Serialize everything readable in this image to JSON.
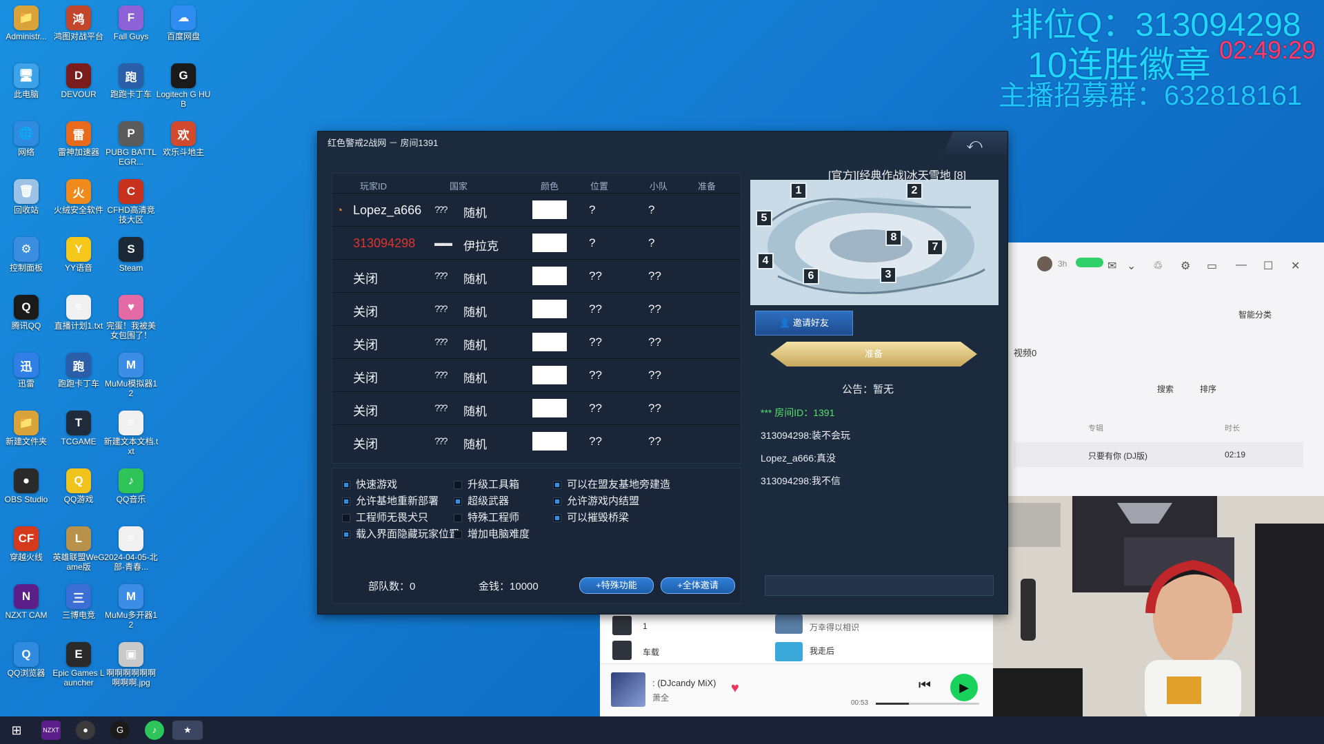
{
  "desktop_icons": [
    {
      "label": "Administr...",
      "color": "#d9a33a",
      "glyph": "📁"
    },
    {
      "label": "鸿图对战平台",
      "color": "#c2462c",
      "glyph": "鸿"
    },
    {
      "label": "Fall Guys",
      "color": "#8c62d6",
      "glyph": "F"
    },
    {
      "label": "百度网盘",
      "color": "#2f8cf0",
      "glyph": "☁"
    },
    {
      "label": "此电脑",
      "color": "#3da2e8",
      "glyph": "🖥"
    },
    {
      "label": "DEVOUR",
      "color": "#7a1c1c",
      "glyph": "D"
    },
    {
      "label": "跑跑卡丁车",
      "color": "#2b5ea8",
      "glyph": "跑"
    },
    {
      "label": "Logitech G HUB",
      "color": "#1a1a1a",
      "glyph": "G"
    },
    {
      "label": "网络",
      "color": "#2f8be0",
      "glyph": "🌐"
    },
    {
      "label": "雷神加速器",
      "color": "#e86a1c",
      "glyph": "雷"
    },
    {
      "label": "PUBG BATTLEGR...",
      "color": "#5b5b5b",
      "glyph": "P"
    },
    {
      "label": "欢乐斗地主",
      "color": "#d24a2e",
      "glyph": "欢"
    },
    {
      "label": "回收站",
      "color": "#9cc3e6",
      "glyph": "🗑"
    },
    {
      "label": "火绒安全软件",
      "color": "#f08a1c",
      "glyph": "火"
    },
    {
      "label": "CFHD高清竞技大区",
      "color": "#c7321e",
      "glyph": "C"
    },
    {
      "label": "",
      "color": "transparent",
      "glyph": ""
    },
    {
      "label": "控制面板",
      "color": "#3b8de0",
      "glyph": "⚙"
    },
    {
      "label": "YY语音",
      "color": "#f5c71a",
      "glyph": "Y"
    },
    {
      "label": "Steam",
      "color": "#1b2838",
      "glyph": "S"
    },
    {
      "label": "",
      "color": "transparent",
      "glyph": ""
    },
    {
      "label": "腾讯QQ",
      "color": "#1a1a1a",
      "glyph": "Q"
    },
    {
      "label": "直播计划1.txt",
      "color": "#f0f0f0",
      "glyph": "≡"
    },
    {
      "label": "完蛋！我被美女包围了！",
      "color": "#e46aa6",
      "glyph": "♥"
    },
    {
      "label": "",
      "color": "transparent",
      "glyph": ""
    },
    {
      "label": "迅雷",
      "color": "#2f7fe6",
      "glyph": "迅"
    },
    {
      "label": "跑跑卡丁车",
      "color": "#2b5ea8",
      "glyph": "跑"
    },
    {
      "label": "MuMu模拟器12",
      "color": "#3b8de6",
      "glyph": "M"
    },
    {
      "label": "",
      "color": "transparent",
      "glyph": ""
    },
    {
      "label": "新建文件夹",
      "color": "#d9a33a",
      "glyph": "📁"
    },
    {
      "label": "TCGAME",
      "color": "#1f2a3a",
      "glyph": "T"
    },
    {
      "label": "新建文本文档.txt",
      "color": "#f0f0f0",
      "glyph": "≡"
    },
    {
      "label": "",
      "color": "transparent",
      "glyph": ""
    },
    {
      "label": "OBS Studio",
      "color": "#2a2a2a",
      "glyph": "●"
    },
    {
      "label": "QQ游戏",
      "color": "#f0c21c",
      "glyph": "Q"
    },
    {
      "label": "QQ音乐",
      "color": "#2fc45a",
      "glyph": "♪"
    },
    {
      "label": "",
      "color": "transparent",
      "glyph": ""
    },
    {
      "label": "穿越火线",
      "color": "#d63a1c",
      "glyph": "CF"
    },
    {
      "label": "英雄联盟WeGame版",
      "color": "#b8914a",
      "glyph": "L"
    },
    {
      "label": "2024-04-05-北部-青春...",
      "color": "#f0f0f0",
      "glyph": "≡"
    },
    {
      "label": "",
      "color": "transparent",
      "glyph": ""
    },
    {
      "label": "NZXT CAM",
      "color": "#5c1f8a",
      "glyph": "N"
    },
    {
      "label": "三博电竞",
      "color": "#3b6fd6",
      "glyph": "三"
    },
    {
      "label": "MuMu多开器12",
      "color": "#3b8de6",
      "glyph": "M"
    },
    {
      "label": "",
      "color": "transparent",
      "glyph": ""
    },
    {
      "label": "QQ浏览器",
      "color": "#2f8be0",
      "glyph": "Q"
    },
    {
      "label": "Epic Games Launcher",
      "color": "#2a2a2a",
      "glyph": "E"
    },
    {
      "label": "啊啊啊啊啊啊啊啊啊.jpg",
      "color": "#c9c9c9",
      "glyph": "▣"
    }
  ],
  "overlay": {
    "line1": "排位Q：313094298",
    "line2": "10连胜徽章",
    "time": "02:49:29",
    "line3": "主播招募群：632818161"
  },
  "game": {
    "title": "红色警戒2战网 － 房间1391",
    "headers": {
      "id": "玩家ID",
      "nation": "国家",
      "color": "颜色",
      "position": "位置",
      "team": "小队",
      "ready": "准备"
    },
    "players": [
      {
        "id": "Lopez_a666",
        "flag": "???",
        "nation": "随机",
        "pos": "?",
        "team": "?",
        "id_color": "#f1f4f8"
      },
      {
        "id": "313094298",
        "flag": "▬▬",
        "nation": "伊拉克",
        "pos": "?",
        "team": "?",
        "id_color": "#e0332e"
      },
      {
        "id": "关闭",
        "flag": "???",
        "nation": "随机",
        "pos": "??",
        "team": "??",
        "id_color": "#f1f4f8"
      },
      {
        "id": "关闭",
        "flag": "???",
        "nation": "随机",
        "pos": "??",
        "team": "??",
        "id_color": "#f1f4f8"
      },
      {
        "id": "关闭",
        "flag": "???",
        "nation": "随机",
        "pos": "??",
        "team": "??",
        "id_color": "#f1f4f8"
      },
      {
        "id": "关闭",
        "flag": "???",
        "nation": "随机",
        "pos": "??",
        "team": "??",
        "id_color": "#f1f4f8"
      },
      {
        "id": "关闭",
        "flag": "???",
        "nation": "随机",
        "pos": "??",
        "team": "??",
        "id_color": "#f1f4f8"
      },
      {
        "id": "关闭",
        "flag": "???",
        "nation": "随机",
        "pos": "??",
        "team": "??",
        "id_color": "#f1f4f8"
      }
    ],
    "options": [
      {
        "label": "快速游戏",
        "on": true
      },
      {
        "label": "升级工具箱",
        "on": false
      },
      {
        "label": "可以在盟友基地旁建造",
        "on": true
      },
      {
        "label": "允许基地重新部署",
        "on": true
      },
      {
        "label": "超级武器",
        "on": true
      },
      {
        "label": "允许游戏内结盟",
        "on": true
      },
      {
        "label": "工程师无畏犬只",
        "on": false
      },
      {
        "label": "特殊工程师",
        "on": false
      },
      {
        "label": "可以摧毁桥梁",
        "on": true
      },
      {
        "label": "载入界面隐藏玩家位置",
        "on": true
      },
      {
        "label": "增加电脑难度",
        "on": false
      }
    ],
    "units_label": "部队数：",
    "units_value": "0",
    "money_label": "金钱：",
    "money_value": "10000",
    "special_btn": "+特殊功能",
    "invite_all_btn": "+全体邀请",
    "map_title": "[官方][经典作战]冰天雪地 [8]",
    "map_numbers": [
      "1",
      "2",
      "5",
      "8",
      "7",
      "4",
      "6",
      "3"
    ],
    "invite_btn": "邀请好友",
    "ready_btn": "准备",
    "notice": "公告：暂无",
    "chat": [
      {
        "text": "*** 房间ID：1391",
        "sys": true
      },
      {
        "text": "313094298:装不会玩",
        "sys": false
      },
      {
        "text": "Lopez_a666:真没",
        "sys": false
      },
      {
        "text": "313094298:我不信",
        "sys": false
      }
    ]
  },
  "appwin": {
    "avatar_time": "3h",
    "smart_sort": "智能分类",
    "videos": "视频0",
    "search": "搜索",
    "sort": "排序",
    "col_album": "专辑",
    "col_duration": "时长",
    "row_album": "只要有你 (DJ版)",
    "row_duration": "02:19"
  },
  "music": {
    "list1": "1",
    "list2": "车载",
    "rec1_sub": "万幸得以相识",
    "rec2": "我走后",
    "song": ": (DJcandy MiX)",
    "artist": "萧全",
    "elapsed": "00:53",
    "progress": 0.32
  }
}
